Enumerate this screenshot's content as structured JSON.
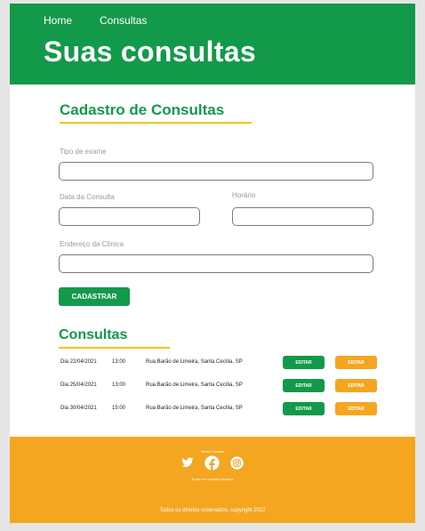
{
  "nav": {
    "home": "Home",
    "consultas": "Consultas"
  },
  "hero": {
    "title": "Suas consultas"
  },
  "form": {
    "title": "Cadastro de Consultas",
    "tipo_label": "Tipo de exame",
    "tipo_value": "",
    "data_label": "Data da Consulta",
    "data_value": "",
    "horario_label": "Horário",
    "horario_value": "",
    "endereco_label": "Endereço da Clínica",
    "endereco_value": "",
    "submit": "CADASTRAR"
  },
  "list": {
    "title": "Consultas",
    "edit_label": "EDITAR",
    "rows": [
      {
        "date": "Dia 22/04/2021",
        "time": "13:00",
        "address": "Rua Barão de Limeira, Santa Cecília, SP"
      },
      {
        "date": "Dia 25/04/2021",
        "time": "13:00",
        "address": "Rua Barão de Limeira, Santa Cecília, SP"
      },
      {
        "date": "Dia 30/04/2021",
        "time": "15:00",
        "address": "Rua Barão de Limeira, Santa Cecília, SP"
      }
    ]
  },
  "footer": {
    "social_label": "Redes Sociais",
    "contact": "Entre em contato conosco",
    "copyright": "Todos os direitos reservados, copyright 2022",
    "icons": [
      "twitter-icon",
      "facebook-icon",
      "instagram-icon"
    ]
  },
  "colors": {
    "green": "#13994a",
    "orange": "#f4a620",
    "yellow": "#f2c219"
  }
}
